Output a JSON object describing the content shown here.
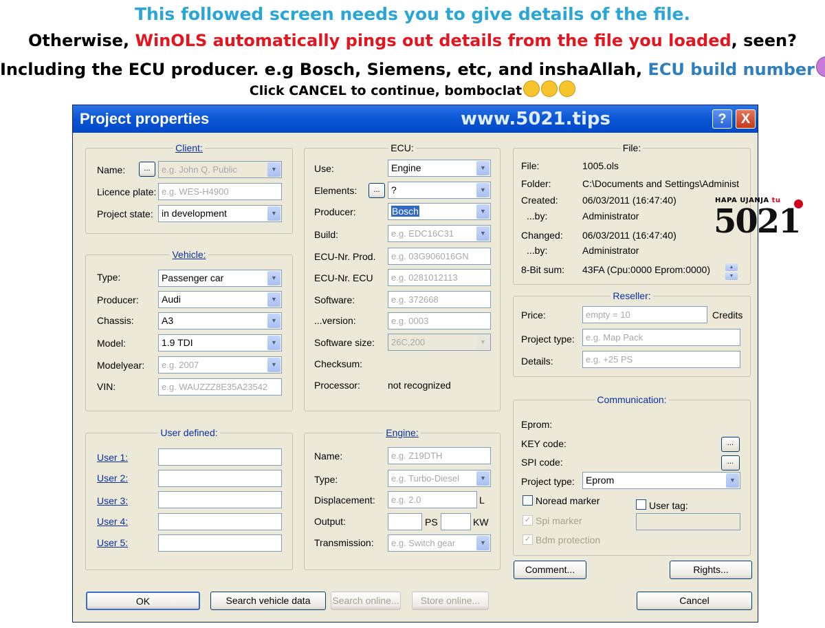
{
  "caption": {
    "line1": "This followed screen needs you to give details of the file.",
    "line2_a": "Otherwise, ",
    "line2_b": "WinOLS automatically pings out details from the file you loaded",
    "line2_c": ", seen?",
    "line3_a": "Including the ECU producer. e.g Bosch, Siemens, etc, and inshaAllah, ",
    "line3_b": "ECU build number",
    "line3_c": "!",
    "line4": "Click CANCEL to continue, bomboclat"
  },
  "logo": {
    "tagline_a": "HAPA UJANJA ",
    "tagline_b": "tu",
    "number": "5021"
  },
  "window": {
    "title": "Project properties",
    "url": "www.5021.tips",
    "help": "?",
    "close": "X"
  },
  "client": {
    "title": "Client:",
    "name_label": "Name:",
    "name_btn": "...",
    "name_placeholder": "e.g. John Q. Public",
    "plate_label": "Licence plate:",
    "plate_placeholder": "e.g. WES-H4900",
    "state_label": "Project state:",
    "state_value": "in development"
  },
  "vehicle": {
    "title": "Vehicle:",
    "type_label": "Type:",
    "type_value": "Passenger car",
    "producer_label": "Producer:",
    "producer_value": "Audi",
    "chassis_label": "Chassis:",
    "chassis_value": "A3",
    "model_label": "Model:",
    "model_value": "1.9 TDI",
    "year_label": "Modelyear:",
    "year_placeholder": "e.g. 2007",
    "vin_label": "VIN:",
    "vin_placeholder": "e.g. WAUZZZ8E35A23542"
  },
  "user_defined": {
    "title": "User defined:",
    "users": [
      "User 1:",
      "User 2:",
      "User 3:",
      "User 4:",
      "User 5:"
    ]
  },
  "ecu": {
    "title": "ECU:",
    "use_label": "Use:",
    "use_value": "Engine",
    "elements_label": "Elements:",
    "elements_btn": "...",
    "elements_value": "?",
    "producer_label": "Producer:",
    "producer_value": "Bosch",
    "build_label": "Build:",
    "build_placeholder": "e.g. EDC16C31",
    "nr_prod_label": "ECU-Nr. Prod.",
    "nr_prod_placeholder": "e.g. 03G906016GN",
    "nr_ecu_label": "ECU-Nr. ECU",
    "nr_ecu_placeholder": "e.g. 0281012113",
    "software_label": "Software:",
    "software_placeholder": "e.g. 372668",
    "version_label": "...version:",
    "version_placeholder": "e.g. 0003",
    "size_label": "Software size:",
    "size_value": "26C,200",
    "checksum_label": "Checksum:",
    "processor_label": "Processor:",
    "processor_value": "not recognized"
  },
  "engine": {
    "title": "Engine:",
    "name_label": "Name:",
    "name_placeholder": "e.g. Z19DTH",
    "type_label": "Type:",
    "type_placeholder": "e.g. Turbo-Diesel",
    "displacement_label": "Displacement:",
    "displacement_placeholder": "e.g. 2.0",
    "displacement_unit": "L",
    "output_label": "Output:",
    "ps_unit": "PS",
    "kw_unit": "KW",
    "transmission_label": "Transmission:",
    "transmission_placeholder": "e.g. Switch gear"
  },
  "file": {
    "title": "File:",
    "file_label": "File:",
    "file_value": "1005.ols",
    "folder_label": "Folder:",
    "folder_value": "C:\\Documents and Settings\\Administ",
    "created_label": "Created:",
    "created_value": "06/03/2011 (16:47:40)",
    "created_by_label": "...by:",
    "created_by_value": "Administrator",
    "changed_label": "Changed:",
    "changed_value": "06/03/2011 (16:47:40)",
    "changed_by_label": "...by:",
    "changed_by_value": "Administrator",
    "sum_label": "8-Bit sum:",
    "sum_value": "43FA  (Cpu:0000  Eprom:0000)"
  },
  "reseller": {
    "title": "Reseller:",
    "price_label": "Price:",
    "price_placeholder": "empty = 10",
    "credits": "Credits",
    "ptype_label": "Project type:",
    "ptype_placeholder": "e.g. Map Pack",
    "details_label": "Details:",
    "details_placeholder": "e.g. +25 PS"
  },
  "communication": {
    "title": "Communication:",
    "eprom_label": "Eprom:",
    "key_label": "KEY code:",
    "key_btn": "...",
    "spi_label": "SPI code:",
    "spi_btn": "...",
    "ptype_label": "Project type:",
    "ptype_value": "Eprom",
    "noread_label": "Noread marker",
    "usertag_label": "User tag:",
    "spi_marker_label": "Spi marker",
    "bdm_label": "Bdm protection",
    "check_mark": "✓"
  },
  "buttons": {
    "comment": "Comment...",
    "rights": "Rights...",
    "ok": "OK",
    "search_vehicle": "Search vehicle data",
    "search_online": "Search online...",
    "store_online": "Store online...",
    "cancel": "Cancel"
  },
  "icons": {
    "dropdown": "▼",
    "spin_up": "▲",
    "spin_down": "▼"
  }
}
